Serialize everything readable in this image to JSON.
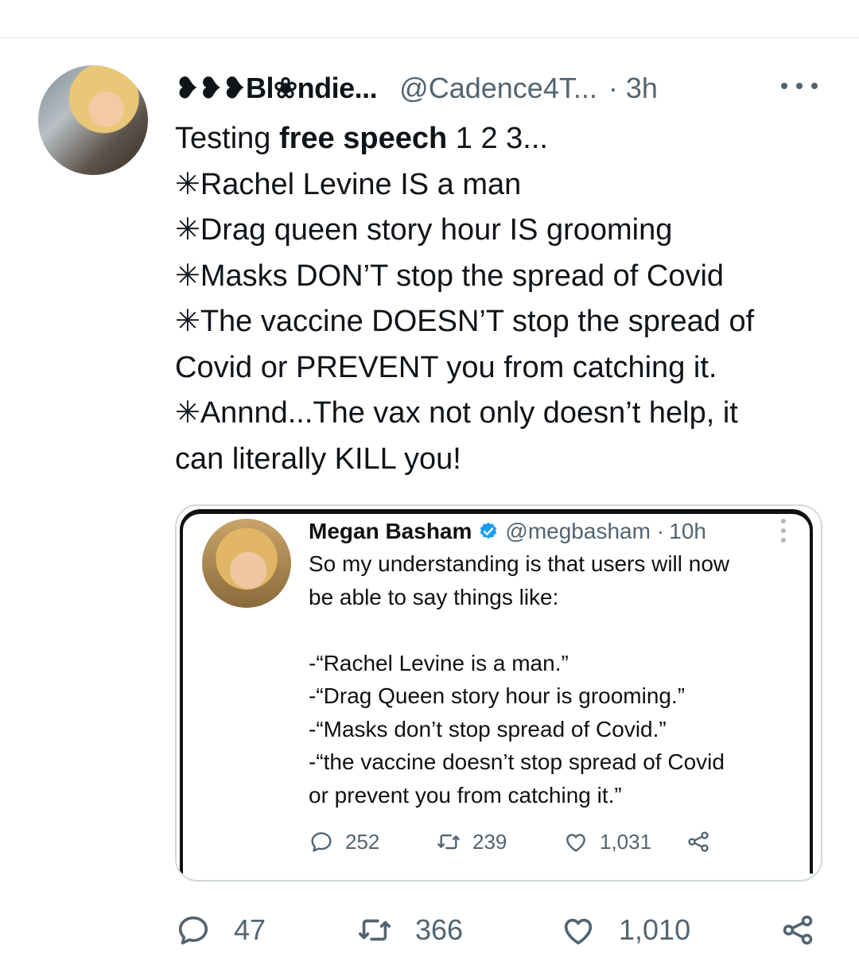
{
  "tweet": {
    "display_name": "❥❥❥Bl❀ndie...",
    "handle": "@Cadence4T...",
    "dot": "·",
    "time": "3h",
    "body_lines": [
      {
        "a": "Testing ",
        "b": "free speech",
        "c": " 1 2 3..."
      },
      "✳Rachel Levine IS a man",
      "✳Drag queen story hour IS grooming",
      "✳Masks DON’T stop the spread of Covid",
      "✳The vaccine DOESN’T stop the spread of",
      "Covid or PREVENT you from catching it.",
      "✳Annnd...The vax not only doesn’t help, it",
      "can literally KILL you!"
    ],
    "actions": {
      "replies": "47",
      "retweets": "366",
      "likes": "1,010"
    }
  },
  "quoted": {
    "display_name": "Megan Basham",
    "handle": "@megbasham",
    "dot": "·",
    "time": "10h",
    "text_lines": [
      "So my understanding is that users will now",
      "be able to say things like:",
      "",
      "-“Rachel Levine is a man.”",
      "-“Drag Queen story hour is grooming.”",
      "-“Masks don’t stop spread of Covid.”",
      "-“the vaccine doesn’t stop spread of Covid",
      "or prevent you from catching it.”"
    ],
    "actions": {
      "replies": "252",
      "retweets": "239",
      "likes": "1,031"
    }
  },
  "colors": {
    "text": "#0f1419",
    "secondary": "#536471",
    "verified": "#1d9bf0",
    "border": "#cfd9de"
  },
  "icons": [
    "more-icon",
    "verified-icon",
    "reply-icon",
    "retweet-icon",
    "like-icon",
    "share-icon"
  ]
}
